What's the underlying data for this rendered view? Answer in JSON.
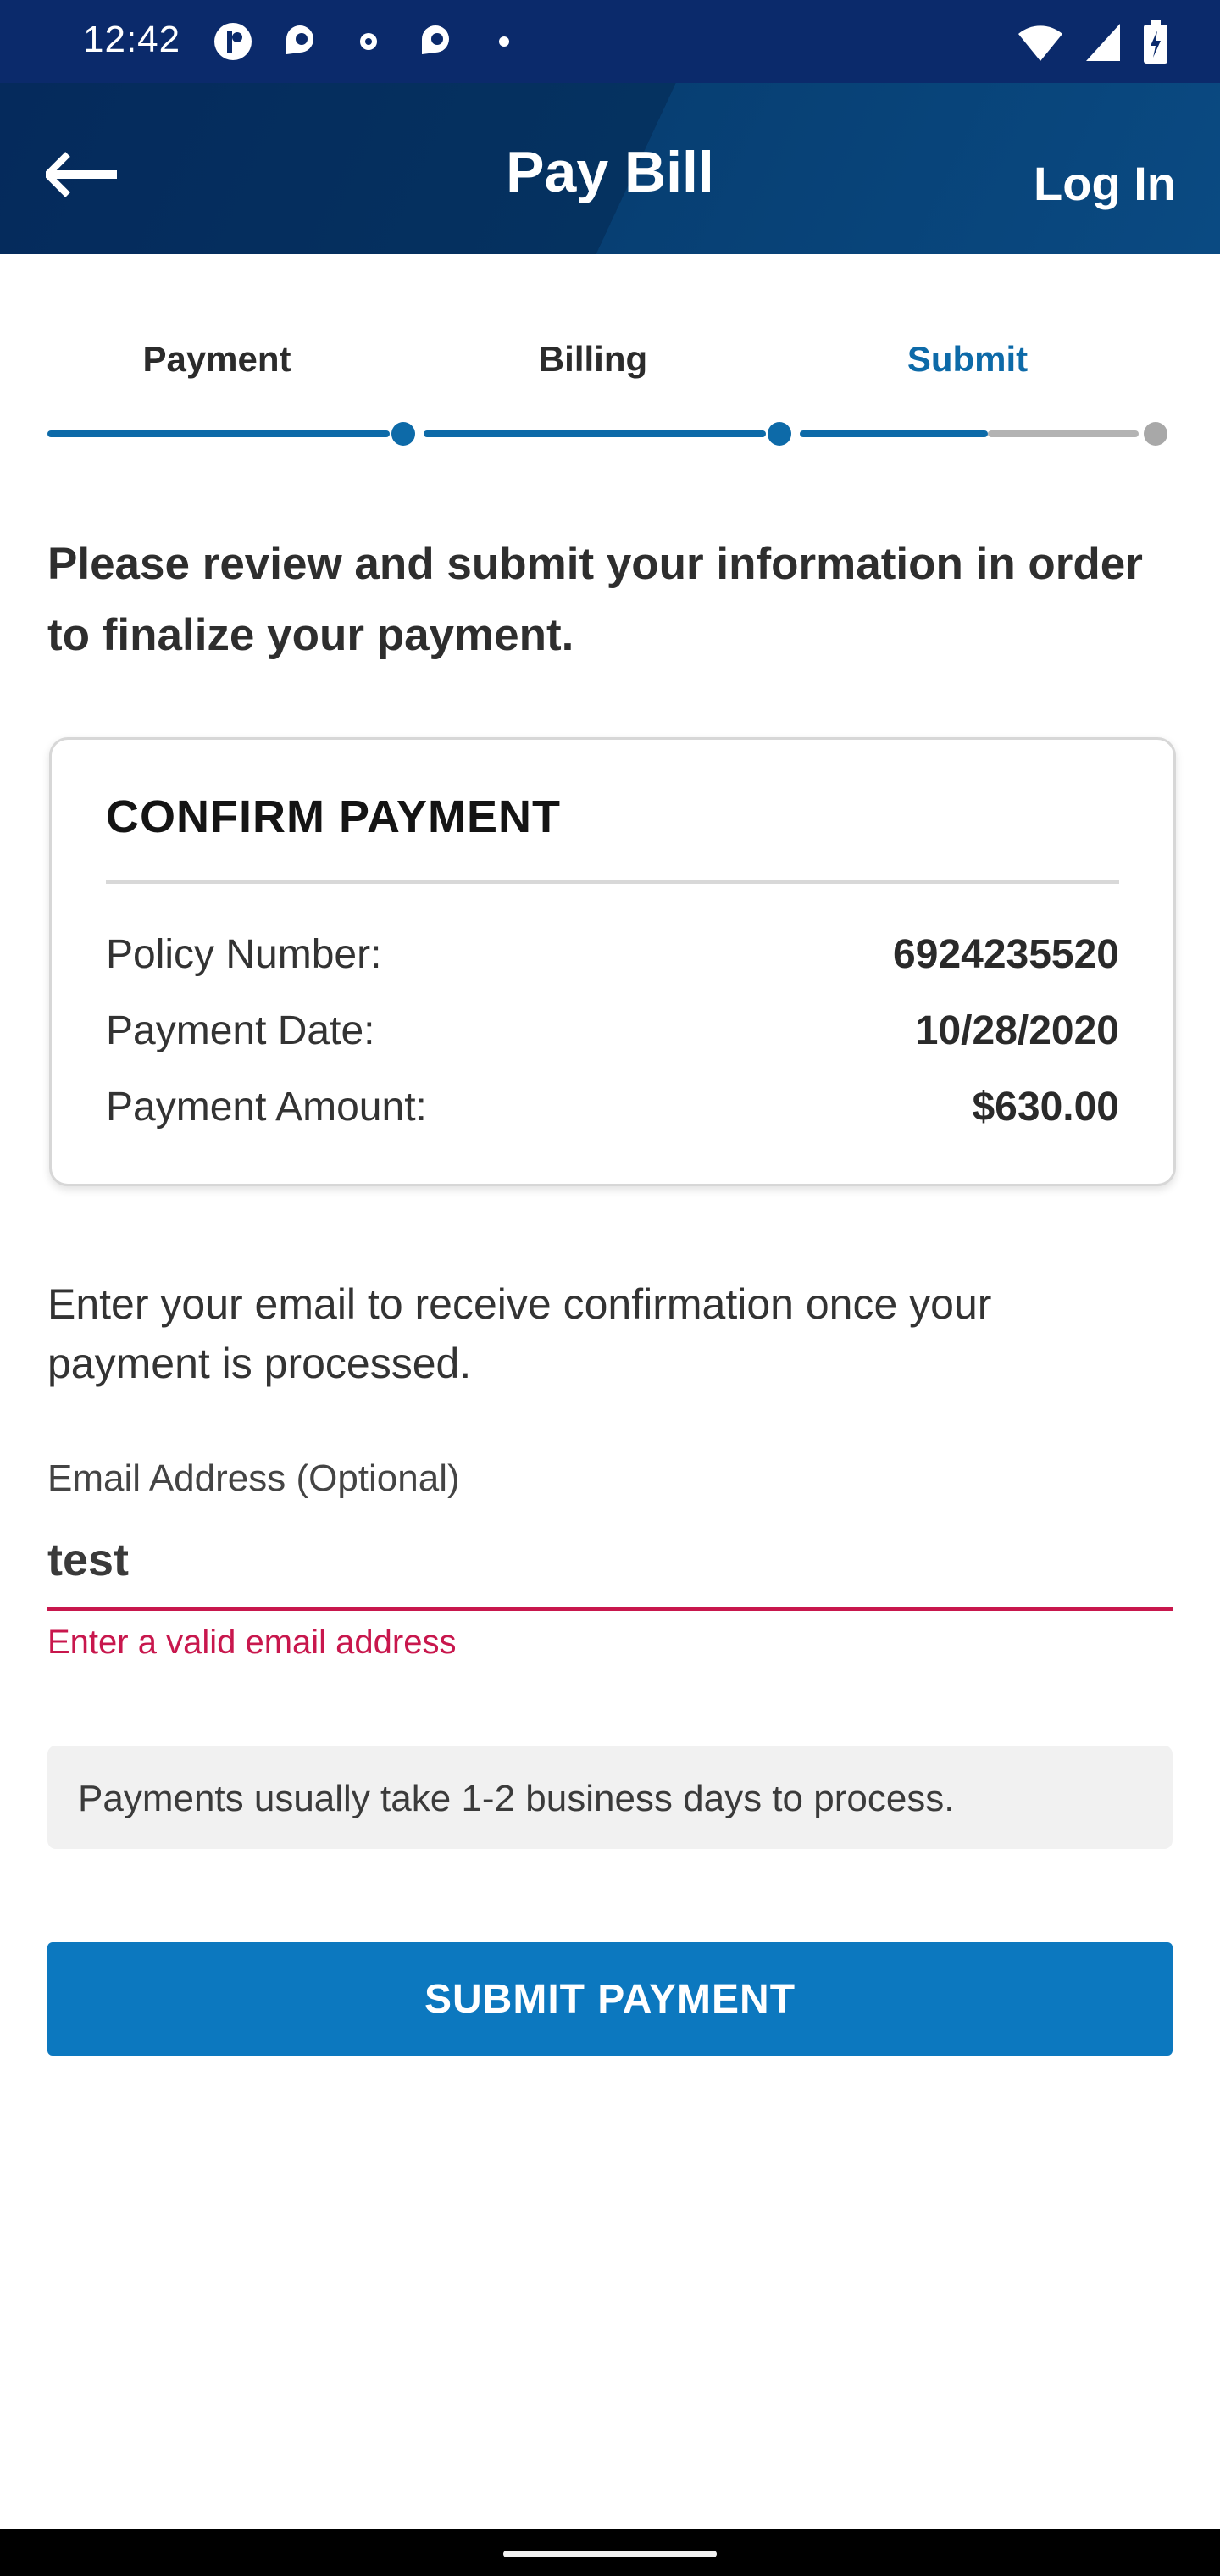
{
  "status_bar": {
    "time": "12:42",
    "left_icons": [
      "notification-icon",
      "app-icon",
      "small-dot-icon",
      "app-icon",
      "dot-icon"
    ],
    "right_icons": [
      "wifi-icon",
      "signal-icon",
      "battery-icon"
    ]
  },
  "header": {
    "back_icon": "arrow-left-icon",
    "title": "Pay Bill",
    "login_label": "Log In",
    "colors": {
      "bg_dark": "#052a5c",
      "bg_light": "#0a4a82"
    }
  },
  "steps": {
    "items": [
      {
        "label": "Payment",
        "state": "completed"
      },
      {
        "label": "Billing",
        "state": "completed"
      },
      {
        "label": "Submit",
        "state": "current"
      }
    ],
    "progress_fraction": 0.85,
    "colors": {
      "active": "#0d6aa8",
      "inactive": "#b3b3b3"
    }
  },
  "intro_text": "Please review and submit your information in order to finalize your payment.",
  "confirm_card": {
    "title": "CONFIRM PAYMENT",
    "rows": [
      {
        "label": "Policy Number:",
        "value": "6924235520"
      },
      {
        "label": "Payment Date:",
        "value": "10/28/2020"
      },
      {
        "label": "Payment Amount:",
        "value": "$630.00"
      }
    ]
  },
  "email": {
    "note": "Enter your email to receive confirmation once your payment is processed.",
    "label": "Email Address (Optional)",
    "value": "test",
    "error": "Enter a valid email address",
    "error_color": "#c8174d"
  },
  "info_message": "Payments usually take 1-2 business days to process.",
  "submit_label": "SUBMIT PAYMENT",
  "accent_color": "#0c78bf"
}
